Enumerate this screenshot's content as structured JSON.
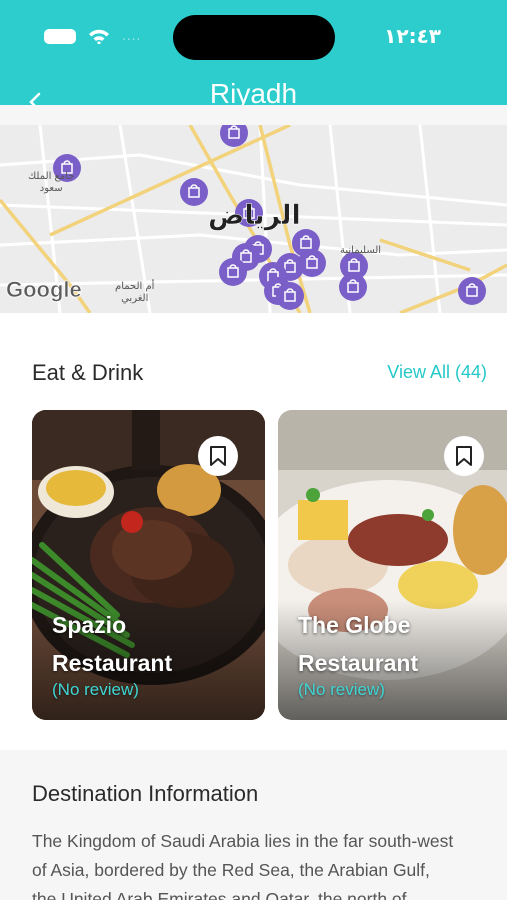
{
  "status_bar": {
    "time": "١٢:٤٣",
    "signal": "....",
    "icons": [
      "battery-icon",
      "wifi-icon",
      "signal-icon"
    ]
  },
  "header": {
    "title": "Riyadh",
    "back_icon": "chevron-left-icon",
    "background": "#2ccdcc"
  },
  "map": {
    "city_label": "الرياض",
    "provider": "Google",
    "labels": [
      {
        "text": "جامع الملك\nسعود"
      },
      {
        "text": "السليمانية"
      },
      {
        "text": "أم الحمام\nالغربي"
      }
    ],
    "marker_icon": "shopping-bag-icon",
    "marker_color": "#7b5fc9"
  },
  "eat_drink": {
    "title": "Eat & Drink",
    "view_all": "View All (44)",
    "cards": [
      {
        "name_line1": "Spazio",
        "name_line2": "Restaurant",
        "review": "(No review)",
        "bookmark_icon": "bookmark-icon"
      },
      {
        "name_line1": "The Globe",
        "name_line2": "Restaurant",
        "review": "(No review)",
        "bookmark_icon": "bookmark-icon"
      }
    ]
  },
  "destination": {
    "title": "Destination Information",
    "lines": [
      "The Kingdom of Saudi Arabia lies in the far south-west",
      "of Asia, bordered by the Red Sea, the Arabian Gulf,",
      "the United Arab Emirates and Qatar, the north of"
    ]
  },
  "colors": {
    "accent": "#2ccdcc",
    "link": "#25c9c8",
    "review": "#3fd6d4"
  }
}
